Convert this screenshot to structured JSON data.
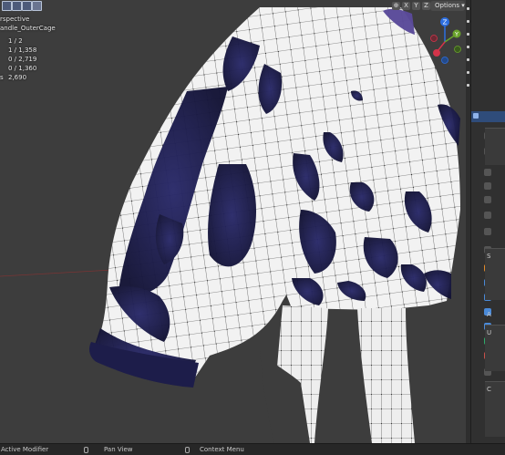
{
  "viewport": {
    "view_name": "rspective",
    "object_name": "andle_OuterCage",
    "stats": [
      {
        "label": "",
        "value": "1 / 2"
      },
      {
        "label": "",
        "value": "1 / 1,358"
      },
      {
        "label": "",
        "value": "0 / 2,719"
      },
      {
        "label": "",
        "value": "0 / 1,360"
      },
      {
        "label": "s",
        "value": "2,690"
      }
    ]
  },
  "header": {
    "options_label": "Options",
    "axis_buttons": [
      "X",
      "Y",
      "Z"
    ]
  },
  "gizmo": {
    "z_label": "Z",
    "y_label": "Y"
  },
  "status_bar": {
    "left_label": "Active Modifier",
    "middle_label": "Pan View",
    "right_label": "Context Menu"
  },
  "right_panel": {
    "section_letters": [
      "S",
      "A",
      "U",
      "C"
    ]
  },
  "colors": {
    "viewport_bg": "#3d3d3d",
    "mesh_white": "#f2f2f2",
    "mesh_navy": "#1c1c4a",
    "wire": "#222222",
    "gizmo_z": "#2c6ee0",
    "gizmo_x": "#d4344a",
    "gizmo_y": "#6aa32b"
  }
}
